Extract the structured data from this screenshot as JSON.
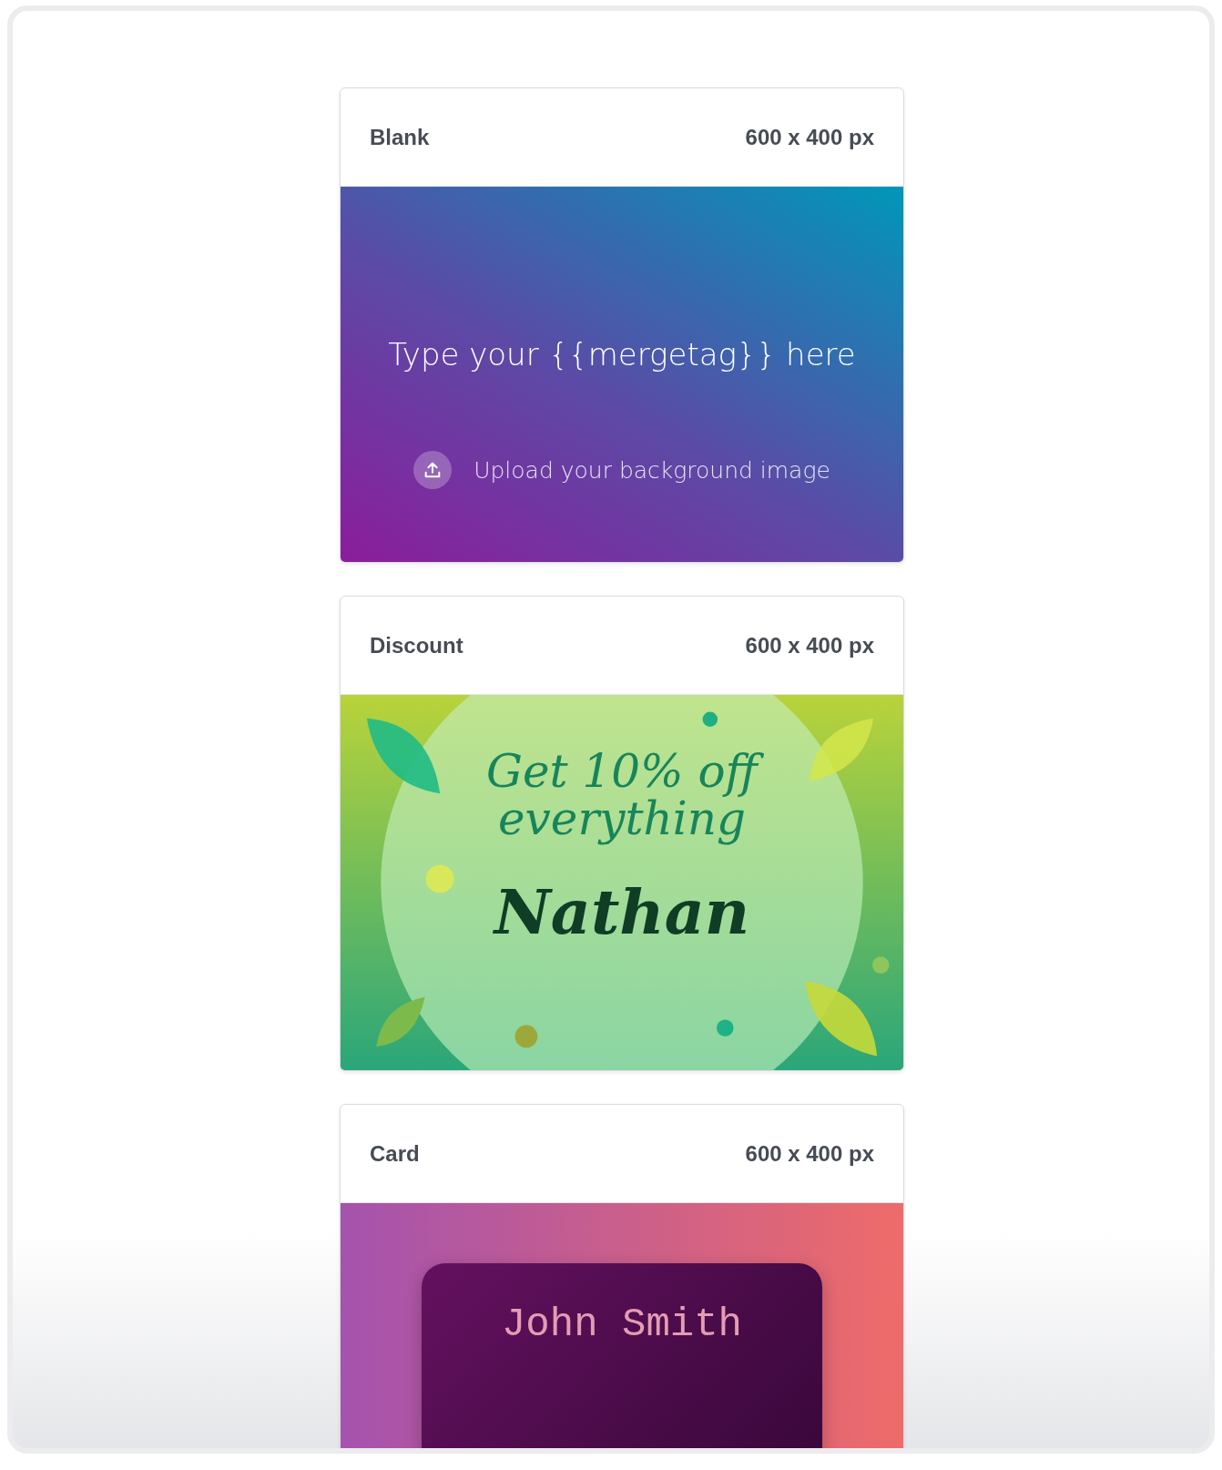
{
  "templates": [
    {
      "kind": "blank",
      "name": "Blank",
      "size": "600 x 400 px",
      "headline": "Type your {{mergetag}} here",
      "upload_label": "Upload your background image"
    },
    {
      "kind": "discount",
      "name": "Discount",
      "size": "600 x 400 px",
      "headline": "Get 10% off everything",
      "recipient": "Nathan"
    },
    {
      "kind": "card",
      "name": "Card",
      "size": "600 x 400 px",
      "holder": "John Smith"
    }
  ]
}
